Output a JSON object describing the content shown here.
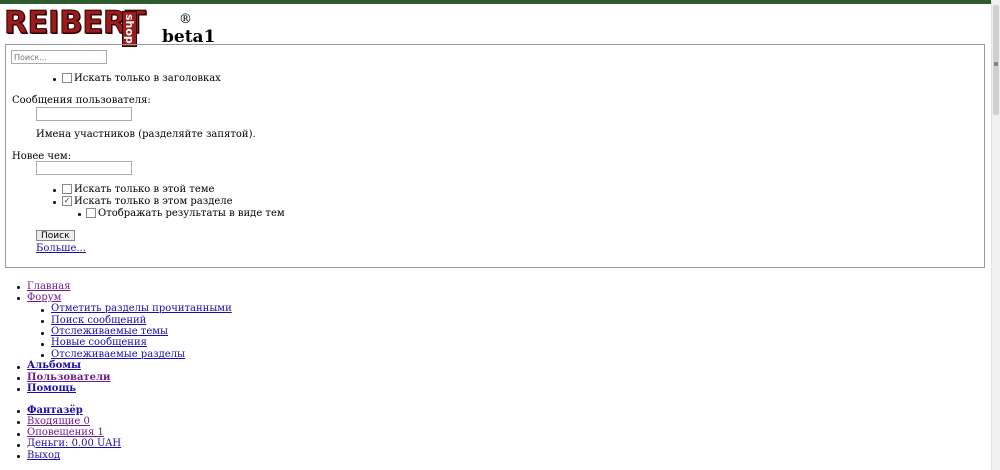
{
  "logo": {
    "text": "REIBERT",
    "tag": "shop",
    "reg": "®",
    "beta": "beta1"
  },
  "search": {
    "placeholder": "Поиск...",
    "titles_only": "Искать только в заголовках",
    "user_messages_label": "Сообщения пользователя:",
    "members_hint": "Имена участников (разделяйте запятой).",
    "newer_label": "Новее чем:",
    "this_thread": "Искать только в этой теме",
    "this_section": "Искать только в этом разделе",
    "as_threads": "Отображать результаты в виде тем",
    "search_button": "Поиск",
    "more_link": "Больше..."
  },
  "nav": {
    "home": "Главная",
    "forum": "Форум",
    "forum_sub": [
      "Отметить разделы прочитанными",
      "Поиск сообщений",
      "Отслеживаемые темы",
      "Новые сообщения",
      "Отслеживаемые разделы"
    ],
    "albums": "Альбомы",
    "users": "Пользователи",
    "help": "Помощь"
  },
  "user": {
    "name": "Фантазёр",
    "inbox": "Входящие 0",
    "alerts": "Оповещения 1",
    "money": "Деньги: 0.00 UAH",
    "logout": "Выход"
  },
  "checks": {
    "this_section_checked": true
  }
}
